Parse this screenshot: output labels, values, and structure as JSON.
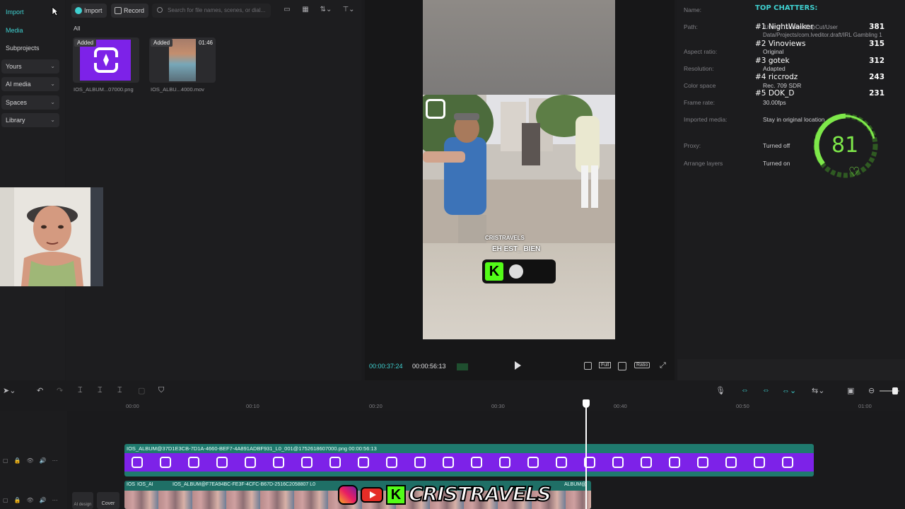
{
  "sidebar": {
    "items": [
      {
        "label": "Import"
      },
      {
        "label": "Media"
      },
      {
        "label": "Subprojects"
      },
      {
        "label": "Yours"
      },
      {
        "label": "AI media"
      },
      {
        "label": "Spaces"
      },
      {
        "label": "Library"
      }
    ]
  },
  "media": {
    "import_label": "Import",
    "record_label": "Record",
    "search_placeholder": "Search for file names, scenes, or dial...",
    "filter_all": "All",
    "items": [
      {
        "tag": "Added",
        "name": "IOS_ALBUM...07000.png",
        "duration": ""
      },
      {
        "tag": "Added",
        "name": "IOS_ALBU...4000.mov",
        "duration": "01:46"
      }
    ]
  },
  "player": {
    "caption_top": "CRISTRAVELS",
    "caption": "EH EST_ BIEN",
    "current_time": "00:00:37:24",
    "total_time": "00:00:56:13",
    "full_label": "Full",
    "ratio_label": "Ratio"
  },
  "details": {
    "rows": [
      {
        "label": "Name:",
        "value": ""
      },
      {
        "label": "Path:",
        "value": "/Users/...Movies/CapCut/User Data/Projects/com.lveditor.draft/IRL Gambling 1"
      },
      {
        "label": "Aspect ratio:",
        "value": "Original"
      },
      {
        "label": "Resolution:",
        "value": "Adapted"
      },
      {
        "label": "Color space",
        "value": "Rec. 709 SDR"
      },
      {
        "label": "Frame rate:",
        "value": "30.00fps"
      },
      {
        "label": "Imported media:",
        "value": "Stay in original location"
      },
      {
        "label": "Proxy:",
        "value": "Turned off"
      },
      {
        "label": "Arrange layers",
        "value": "Turned on"
      }
    ]
  },
  "overlay": {
    "title": "TOP CHATTERS:",
    "chatters": [
      {
        "rank": "#1",
        "name": "NightWalker",
        "count": "381"
      },
      {
        "rank": "#2",
        "name": "Vinoviews",
        "count": "315"
      },
      {
        "rank": "#3",
        "name": "gotek",
        "count": "312"
      },
      {
        "rank": "#4",
        "name": "riccrodz",
        "count": "243"
      },
      {
        "rank": "#5",
        "name": "DOK_D",
        "count": "231"
      }
    ],
    "heart_rate": "81",
    "accent": "#7ee84a"
  },
  "timeline": {
    "ticks": [
      "00:00",
      "00:10",
      "00:20",
      "00:30",
      "00:40",
      "00:50",
      "01:00"
    ],
    "clip_main_label": "IOS_ALBUM@37D1E3CB-7D1A-4660-BEF7-4A891ADBF931_L0_001@1752618607000.png  00:00:56:13",
    "clip_second_labels": [
      "IOS",
      "IOS_AI",
      "IOS_ALBUM@F7EA94BC-FE3F-4CFC-B67D-2516C2058807 L0",
      "ALBUM@"
    ],
    "cover_label": "Cover",
    "ai_label": "AI design"
  },
  "brand": {
    "name": "CRISTRAVELS"
  },
  "colors": {
    "accent_teal": "#3fd0d0",
    "clip_purple": "#7d22e8",
    "clip_teal": "#1f7a6e"
  }
}
